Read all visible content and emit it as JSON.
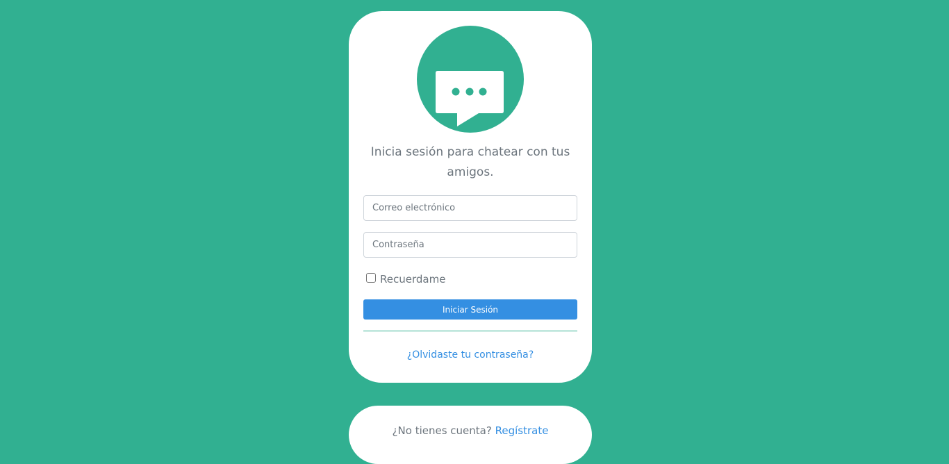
{
  "colors": {
    "background": "#31b091",
    "accent_blue": "#348fe2",
    "card": "#ffffff",
    "muted_text": "#6c757d"
  },
  "logo": {
    "icon": "chat-bubble-icon"
  },
  "login": {
    "tagline": "Inicia sesión para chatear con tus amigos.",
    "email_placeholder": "Correo electrónico",
    "password_placeholder": "Contraseña",
    "remember_label": "Recuerdame",
    "remember_checked": false,
    "submit_label": "Iniciar Sesión",
    "forgot_label": "¿Olvidaste tu contraseña?"
  },
  "signup": {
    "prompt": "¿No tienes cuenta?",
    "link_label": "Regístrate"
  }
}
